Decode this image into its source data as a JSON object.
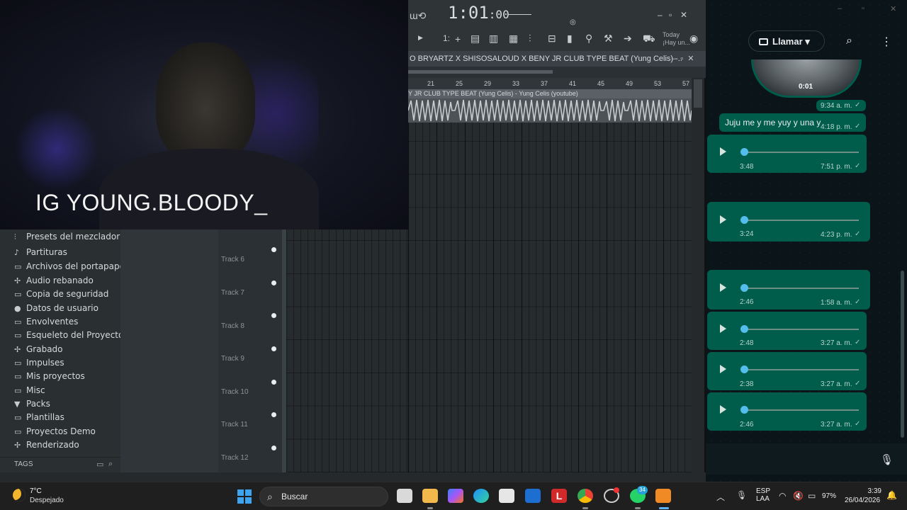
{
  "webcam": {
    "overlay_text": "IG YOUNG.BLOODY_"
  },
  "fl_toolbar": {
    "time_main": "1:01",
    "time_sub": ":00",
    "bpm_digit": "1:",
    "today_label": "Today",
    "hint_text": "¡Hay un..."
  },
  "playlist": {
    "title": "O BRYARTZ X SHISOSALOUD X BENY JR CLUB TYPE BEAT (Yung Celis) -.. ",
    "ruler": [
      "21",
      "25",
      "29",
      "33",
      "37",
      "41",
      "45",
      "49",
      "53",
      "57"
    ],
    "clip_title": "Y JR CLUB TYPE BEAT (Yung Celis) - Yung Celis (youtube)"
  },
  "browser": {
    "items": [
      {
        "icon": "mixer-icon",
        "label": "Presets del mezclador"
      },
      {
        "icon": "note-icon",
        "label": "Partituras"
      },
      {
        "icon": "folder-icon",
        "label": "Archivos del portapapeles"
      },
      {
        "icon": "sliced-audio-icon",
        "label": "Audio rebanado"
      },
      {
        "icon": "backup-folder-icon",
        "label": "Copia de seguridad"
      },
      {
        "icon": "user-icon",
        "label": "Datos de usuario"
      },
      {
        "icon": "folder-icon",
        "label": "Envolventes"
      },
      {
        "icon": "folder-icon",
        "label": "Esqueleto del Proyecto"
      },
      {
        "icon": "record-icon",
        "label": "Grabado"
      },
      {
        "icon": "folder-icon",
        "label": "Impulses"
      },
      {
        "icon": "folder-icon",
        "label": "Mis proyectos"
      },
      {
        "icon": "folder-icon",
        "label": "Misc"
      },
      {
        "icon": "packs-icon",
        "label": "Packs"
      },
      {
        "icon": "folder-icon",
        "label": "Plantillas"
      },
      {
        "icon": "folder-icon",
        "label": "Proyectos Demo"
      },
      {
        "icon": "render-icon",
        "label": "Renderizado"
      }
    ],
    "tags_label": "TAGS"
  },
  "tracks": [
    "Track 6",
    "Track 7",
    "Track 8",
    "Track 9",
    "Track 10",
    "Track 11",
    "Track 12"
  ],
  "whatsapp": {
    "call_label": "Llamar",
    "image_duration": "0:01",
    "image_time": "9:34 a. m.",
    "text_message": "Juju me y me yuy y una y",
    "text_time": "4:18 p. m.",
    "voice_notes": [
      {
        "duration": "3:48",
        "time": "7:51 p. m."
      },
      {
        "duration": "3:24",
        "time": "4:23 p. m."
      },
      {
        "duration": "2:46",
        "time": "1:58 a. m."
      },
      {
        "duration": "2:48",
        "time": "3:27 a. m."
      },
      {
        "duration": "2:38",
        "time": "3:27 a. m."
      },
      {
        "duration": "2:46",
        "time": "3:27 a. m."
      }
    ]
  },
  "taskbar": {
    "temperature": "7°C",
    "weather": "Despejado",
    "search_placeholder": "Buscar",
    "whatsapp_badge": "34",
    "lang_line1": "ESP",
    "lang_line2": "LAA",
    "battery": "97%",
    "clock_time": "3:39",
    "clock_date": "26/04/2026"
  },
  "colors": {
    "wa_bubble": "#005c4b",
    "wa_accent": "#53bdeb",
    "fl_panel": "#2f3437"
  }
}
